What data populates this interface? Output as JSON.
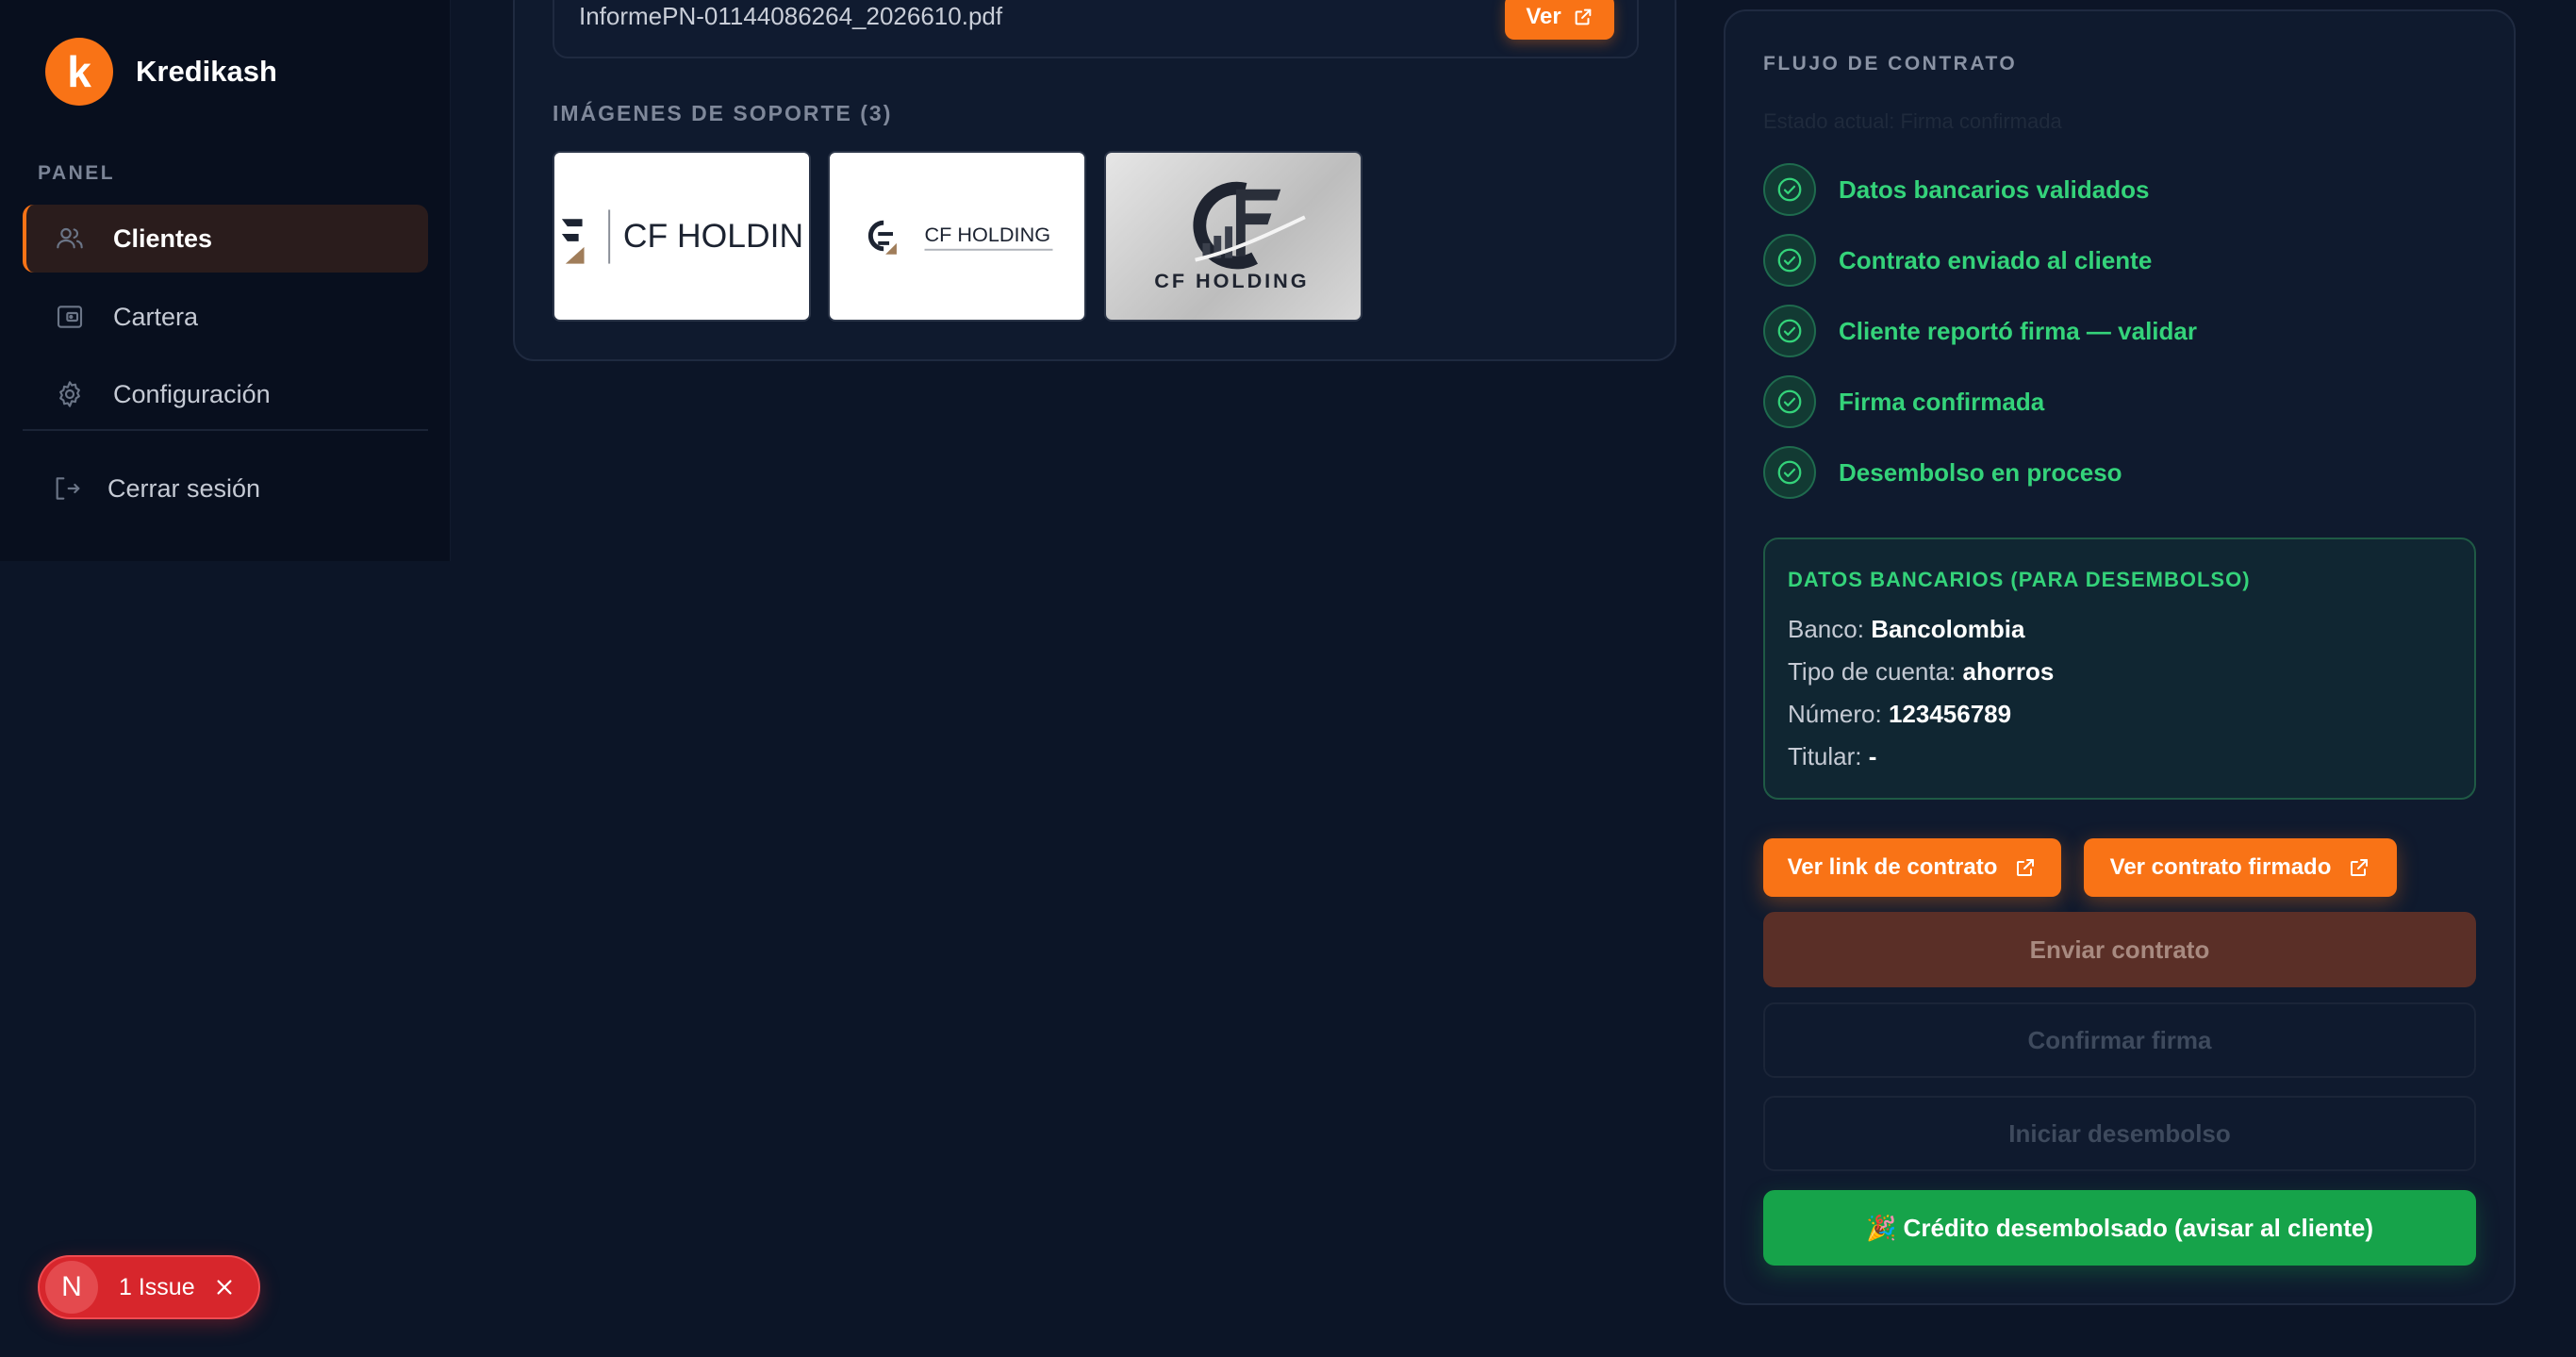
{
  "app": {
    "name": "Kredikash",
    "logo_letter": "k",
    "accent": "#f97316"
  },
  "sidebar": {
    "section_label": "PANEL",
    "items": [
      {
        "label": "Clientes",
        "icon": "users-icon",
        "active": true
      },
      {
        "label": "Cartera",
        "icon": "wallet-icon",
        "active": false
      },
      {
        "label": "Configuración",
        "icon": "gear-icon",
        "active": false
      }
    ],
    "logout_label": "Cerrar sesión"
  },
  "documents": {
    "file_name": "InformePN-01144086264_2026610.pdf",
    "view_label": "Ver",
    "images_label": "IMÁGENES DE SOPORTE (3)",
    "images": [
      {
        "logo_text": "CF HOLDIN"
      },
      {
        "logo_text": "CF HOLDING"
      },
      {
        "logo_text": "CF HOLDING"
      }
    ]
  },
  "flow": {
    "title": "FLUJO DE CONTRATO",
    "status": "Estado actual: Firma confirmada",
    "steps": [
      {
        "label": "Datos bancarios validados"
      },
      {
        "label": "Contrato enviado al cliente"
      },
      {
        "label": "Cliente reportó firma — validar"
      },
      {
        "label": "Firma confirmada"
      },
      {
        "label": "Desembolso en proceso"
      }
    ],
    "bank": {
      "title": "DATOS BANCARIOS (PARA DESEMBOLSO)",
      "banco_label": "Banco:",
      "banco_value": "Bancolombia",
      "tipo_label": "Tipo de cuenta:",
      "tipo_value": "ahorros",
      "numero_label": "Número:",
      "numero_value": "123456789",
      "titular_label": "Titular:",
      "titular_value": "-"
    },
    "buttons": {
      "ver_link": "Ver link de contrato",
      "ver_firmado": "Ver contrato firmado",
      "enviar": "Enviar contrato",
      "confirmar": "Confirmar firma",
      "iniciar": "Iniciar desembolso",
      "credito": "🎉 Crédito desembolsado (avisar al cliente)"
    },
    "success_color": "#34d37a"
  },
  "issue_badge": {
    "avatar": "N",
    "label": "1 Issue"
  }
}
